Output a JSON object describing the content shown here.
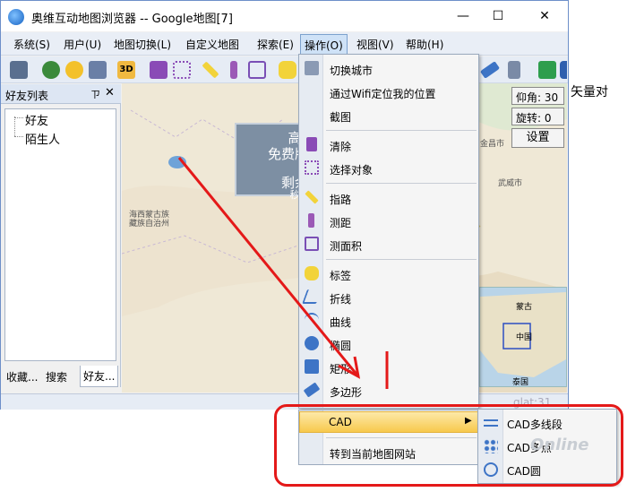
{
  "window": {
    "title": "奥维互动地图浏览器 -- Google地图[7]",
    "minimize": "—",
    "maximize": "☐",
    "close": "✕"
  },
  "menubar": [
    "系统(S)",
    "用户(U)",
    "地图切换(L)",
    "自定义地图",
    "探索(E)",
    "操作(O)",
    "视图(V)",
    "帮助(H)"
  ],
  "leftpanel": {
    "title": "好友列表",
    "pin": "ㄗ",
    "close": "✕",
    "tree": [
      "好友",
      "陌生人"
    ],
    "tabs": [
      "收藏...",
      "搜索",
      "好友..."
    ]
  },
  "map": {
    "popup": [
      "高",
      "免费版本",
      "剩余",
      "秒"
    ],
    "place": [
      "海西蒙古族",
      "藏族自治州"
    ],
    "pitch": "仰角: 30",
    "rotation": "旋转: 0",
    "settings": "设置",
    "minimap_labels": [
      "蒙古",
      "中国",
      "泰国"
    ],
    "labels": [
      "金昌市",
      "武威市"
    ],
    "lat_label": "glat:31"
  },
  "dropdown": {
    "items": [
      "切换城市",
      "通过Wifi定位我的位置",
      "截图",
      "清除",
      "选择对象",
      "指路",
      "测距",
      "测面积",
      "标签",
      "折线",
      "曲线",
      "椭圆",
      "矩形",
      "多边形"
    ]
  },
  "bottommenu": {
    "cad": "CAD",
    "arrow": "▶",
    "goto": "转到当前地图网站"
  },
  "submenu": [
    "CAD多线段",
    "CAD多点",
    "CAD圆"
  ],
  "side_text": "矢量对",
  "watermark": "Online",
  "colors": {
    "accent": "#e41919",
    "highlight": "#f7c94d",
    "menu_active": "#cfe2f7"
  }
}
